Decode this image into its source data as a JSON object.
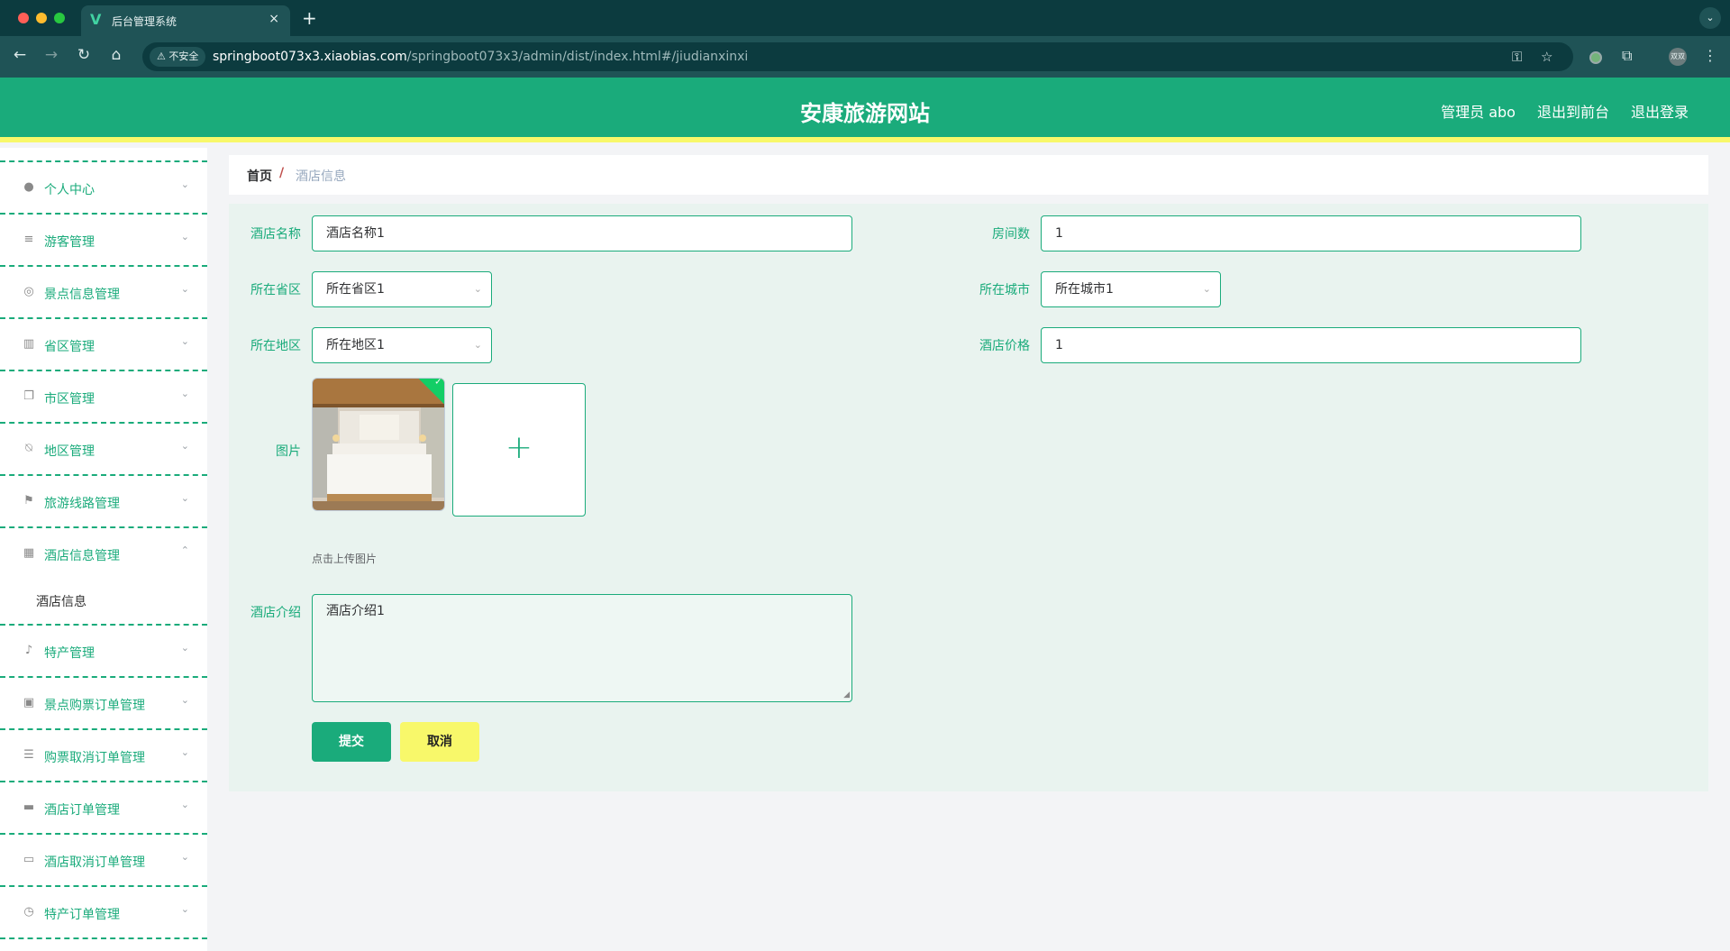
{
  "browser": {
    "tab_title": "后台管理系统",
    "tab_close": "×",
    "new_tab": "+",
    "tab_menu": "⌄",
    "insecure_label": "不安全",
    "url_host": "springboot073x3.xiaobias.com",
    "url_path": "/springboot073x3/admin/dist/index.html#/jiudianxinxi",
    "profile_initials": "双双"
  },
  "header": {
    "title": "安康旅游网站",
    "user": "管理员 abo",
    "to_front": "退出到前台",
    "logout": "退出登录"
  },
  "sidebar": {
    "items": [
      {
        "label": "个人中心",
        "icon": "user-icon"
      },
      {
        "label": "游客管理",
        "icon": "menu-icon"
      },
      {
        "label": "景点信息管理",
        "icon": "compass-icon"
      },
      {
        "label": "省区管理",
        "icon": "library-icon"
      },
      {
        "label": "市区管理",
        "icon": "copy-icon"
      },
      {
        "label": "地区管理",
        "icon": "bell-off-icon"
      },
      {
        "label": "旅游线路管理",
        "icon": "flag-icon"
      },
      {
        "label": "酒店信息管理",
        "icon": "grid-icon"
      },
      {
        "label": "特产管理",
        "icon": "microphone-icon"
      },
      {
        "label": "景点购票订单管理",
        "icon": "clipboard-icon"
      },
      {
        "label": "购票取消订单管理",
        "icon": "list-icon"
      },
      {
        "label": "酒店订单管理",
        "icon": "monitor-icon"
      },
      {
        "label": "酒店取消订单管理",
        "icon": "printer-icon"
      },
      {
        "label": "特产订单管理",
        "icon": "clock-icon"
      }
    ],
    "active_sub": "酒店信息"
  },
  "breadcrumb": {
    "home": "首页",
    "separator": "/",
    "current": "酒店信息"
  },
  "form": {
    "hotel_name_label": "酒店名称",
    "hotel_name_value": "酒店名称1",
    "rooms_label": "房间数",
    "rooms_value": "1",
    "province_label": "所在省区",
    "province_value": "所在省区1",
    "city_label": "所在城市",
    "city_value": "所在城市1",
    "district_label": "所在地区",
    "district_value": "所在地区1",
    "price_label": "酒店价格",
    "price_value": "1",
    "image_label": "图片",
    "upload_plus": "+",
    "upload_tip": "点击上传图片",
    "intro_label": "酒店介绍",
    "intro_value": "酒店介绍1",
    "submit": "提交",
    "cancel": "取消"
  },
  "colors": {
    "primary": "#1aab7b",
    "accent_yellow": "#f8f86a",
    "form_bg": "#e9f3ef"
  }
}
